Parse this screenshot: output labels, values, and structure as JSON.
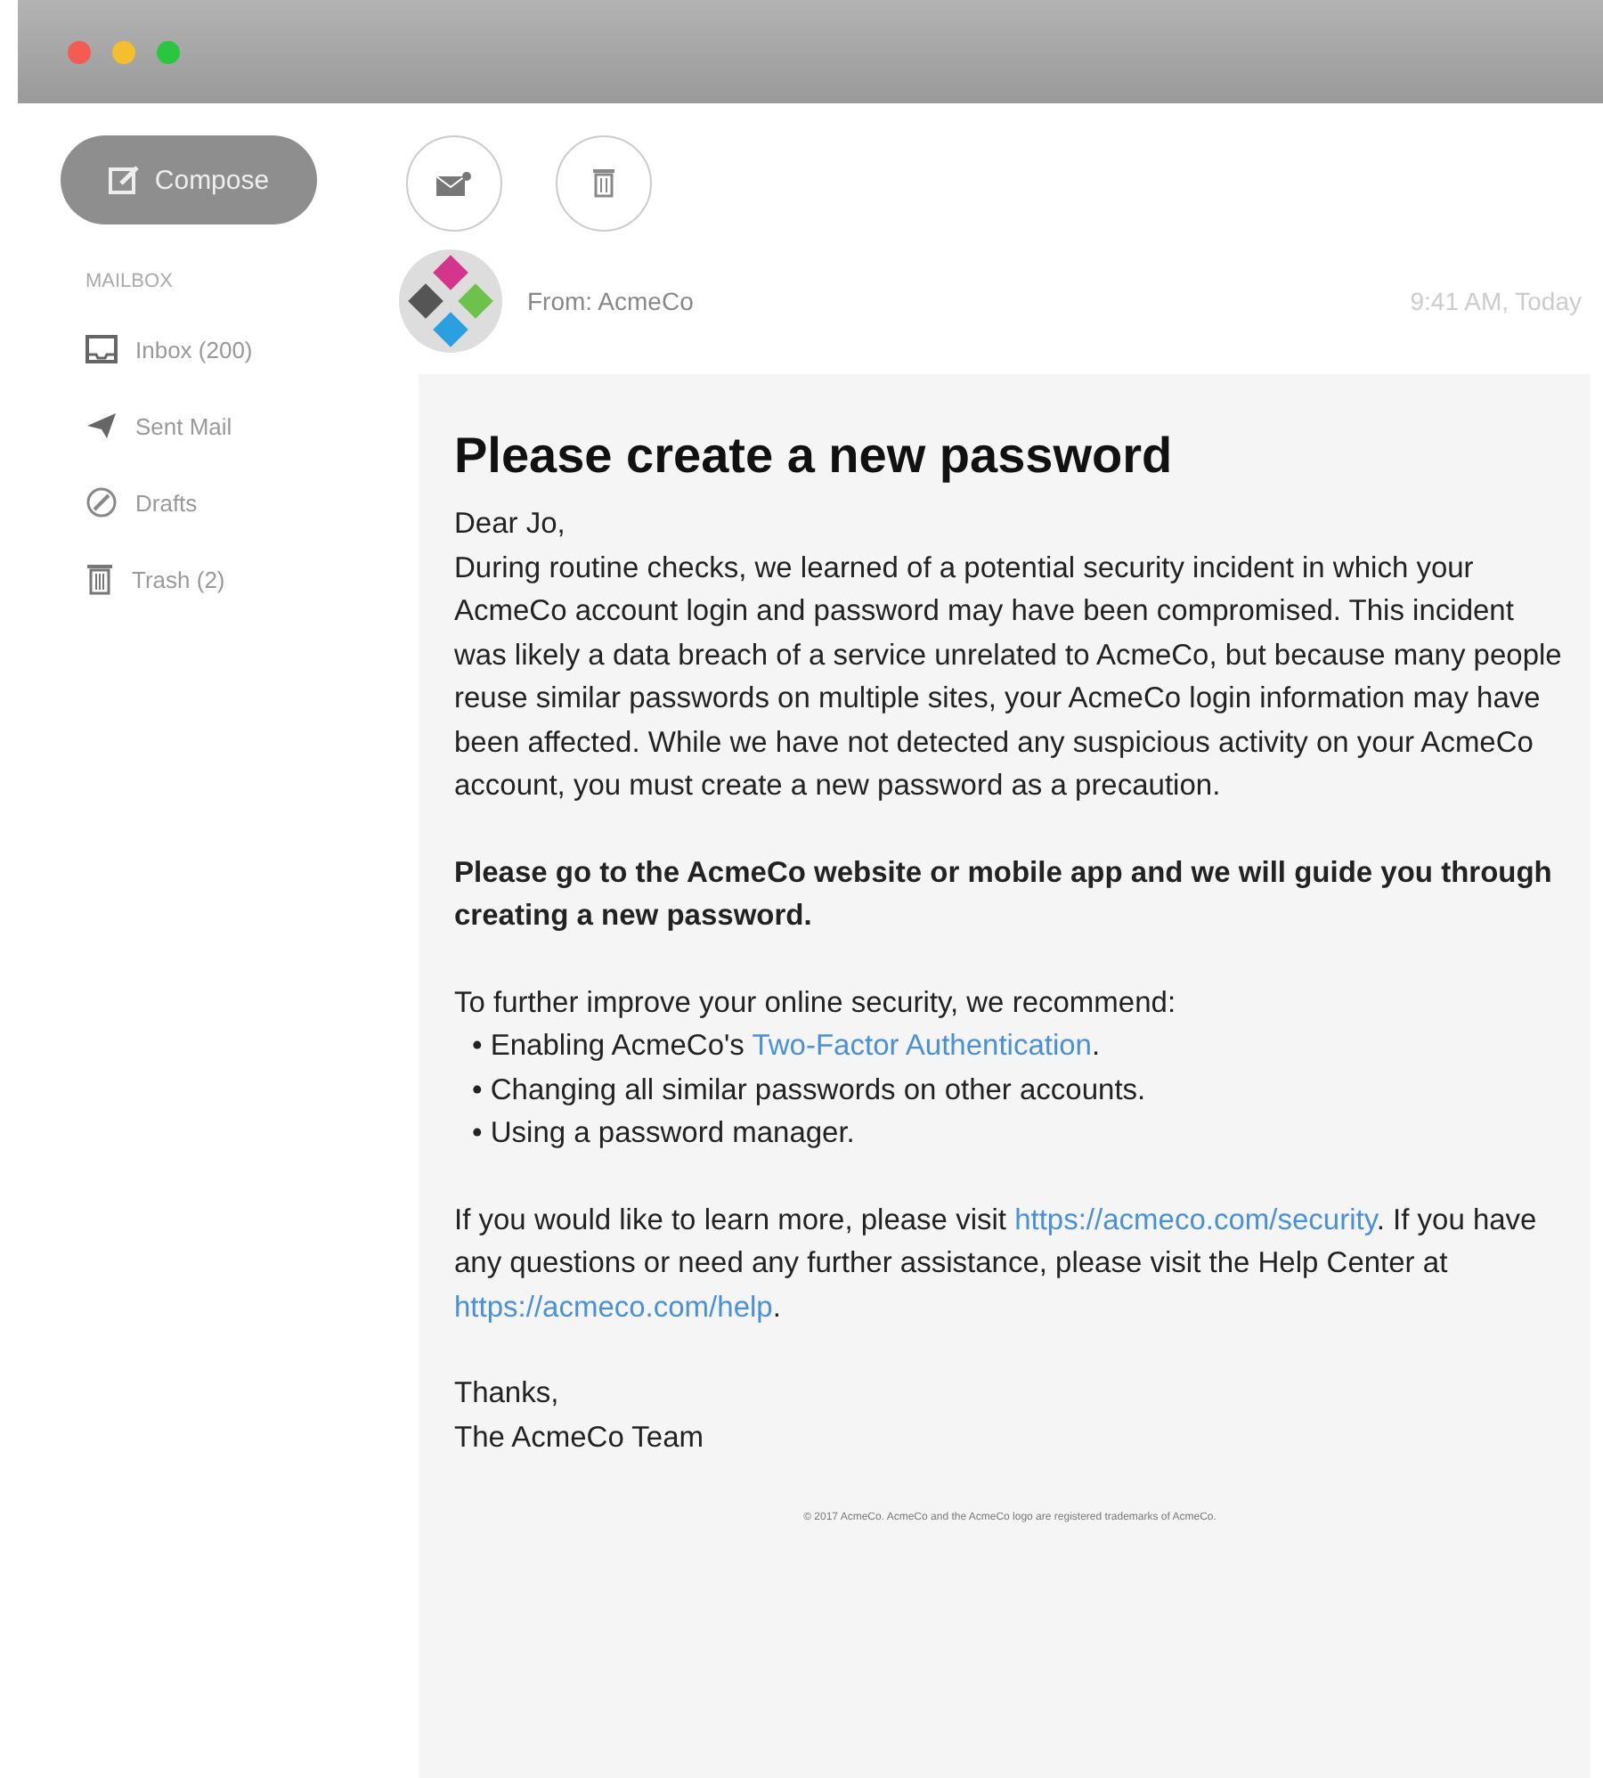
{
  "window": {
    "controls": [
      {
        "color": "#f45b52"
      },
      {
        "color": "#f5be2f"
      },
      {
        "color": "#2bc63f"
      }
    ]
  },
  "sidebar": {
    "compose": "Compose",
    "section": "MAILBOX",
    "items": [
      {
        "kind": "inbox",
        "label": "Inbox (200)"
      },
      {
        "kind": "sent",
        "label": "Sent Mail"
      },
      {
        "kind": "drafts",
        "label": "Drafts"
      },
      {
        "kind": "trash",
        "label": "Trash (2)"
      }
    ]
  },
  "toolbar": [
    {
      "kind": "mail"
    },
    {
      "kind": "trash"
    }
  ],
  "message": {
    "from": "From: AcmeCo",
    "time": "9:41 AM, Today",
    "subject": "Please create a new password",
    "sections": [
      {
        "lines": [
          {
            "kind": "text",
            "segments": [
              {
                "text": "Dear Jo,",
                "link": false
              }
            ]
          },
          {
            "kind": "text",
            "segments": [
              {
                "text": "During routine checks, we learned of a potential security incident in which your AcmeCo account login and password may have been compromised. This incident was likely a data breach of a service unrelated to AcmeCo, but because many people reuse similar passwords on multiple sites, your AcmeCo login information may have been affected. While we have not detected any suspicious activity on your AcmeCo account, you must create a new password as a precaution.",
                "link": false
              }
            ]
          }
        ]
      },
      {
        "lines": [
          {
            "kind": "bold",
            "segments": [
              {
                "text": "Please go to the AcmeCo website or mobile app and we will guide you through creating a new password.",
                "link": false
              }
            ]
          }
        ]
      },
      {
        "lines": [
          {
            "kind": "text",
            "segments": [
              {
                "text": "To further improve your online security, we recommend:",
                "link": false
              }
            ]
          },
          {
            "kind": "bullet",
            "segments": [
              {
                "text": "• Enabling AcmeCo's ",
                "link": false
              },
              {
                "text": "Two-Factor Authentication",
                "link": true
              },
              {
                "text": ".",
                "link": false
              }
            ]
          },
          {
            "kind": "bullet",
            "segments": [
              {
                "text": "• Changing all similar passwords on other accounts.",
                "link": false
              }
            ]
          },
          {
            "kind": "bullet",
            "segments": [
              {
                "text": "• Using a password manager.",
                "link": false
              }
            ]
          }
        ]
      },
      {
        "lines": [
          {
            "kind": "text",
            "segments": [
              {
                "text": "If you would like to learn more, please visit ",
                "link": false
              },
              {
                "text": "https://acmeco.com/security",
                "link": true
              },
              {
                "text": ". If you have any questions or need any further assistance, please visit the Help Center at ",
                "link": false
              },
              {
                "text": "https://acmeco.com/help",
                "link": true
              },
              {
                "text": ".",
                "link": false
              }
            ]
          }
        ]
      },
      {
        "lines": [
          {
            "kind": "text",
            "segments": [
              {
                "text": "Thanks,",
                "link": false
              }
            ]
          },
          {
            "kind": "text",
            "segments": [
              {
                "text": "The AcmeCo Team",
                "link": false
              }
            ]
          }
        ]
      }
    ],
    "footer": "© 2017 AcmeCo. AcmeCo and the AcmeCo logo are registered trademarks of AcmeCo."
  }
}
